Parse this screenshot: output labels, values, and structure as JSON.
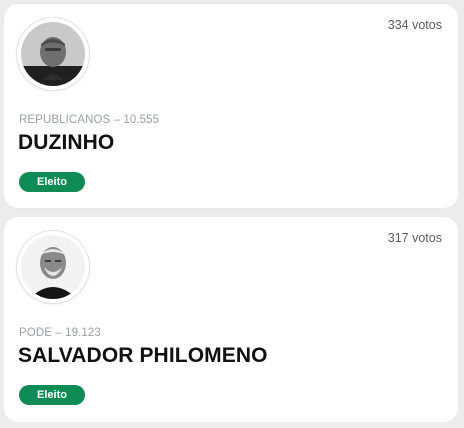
{
  "candidates": [
    {
      "votes": "334 votos",
      "party_line": "REPUBLICANOS – 10.555",
      "name": "DUZINHO",
      "status": "Eleito",
      "status_color": "#0f8b55"
    },
    {
      "votes": "317 votos",
      "party_line": "PODE – 19.123",
      "name": "SALVADOR PHILOMENO",
      "status": "Eleito",
      "status_color": "#0f8b55"
    }
  ],
  "icons": [
    "candidate-photo",
    "candidate-photo"
  ]
}
